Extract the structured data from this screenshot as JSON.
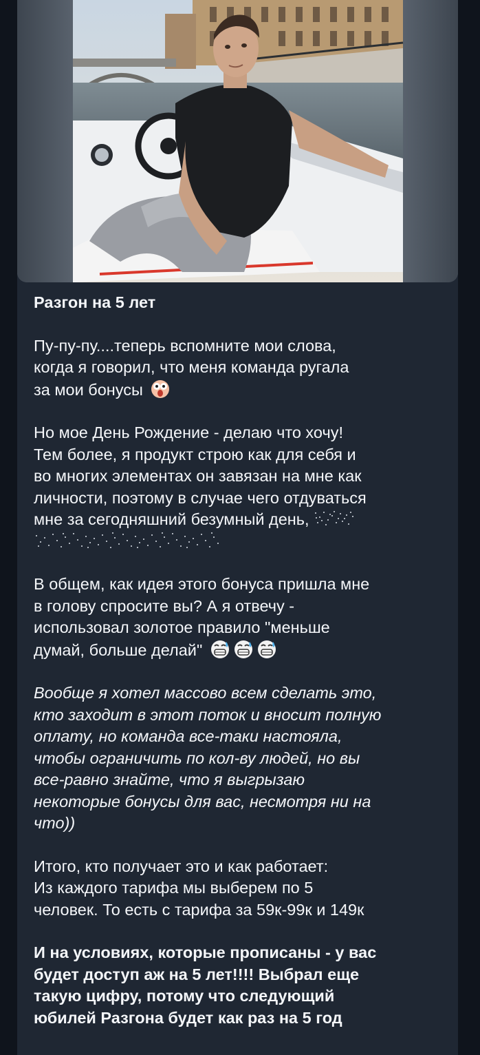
{
  "post": {
    "photo_alt": "photo",
    "title": "Разгон на 5 лет",
    "paragraphs": [
      {
        "style": "normal",
        "lines": [
          "Пу-пу-пу....теперь вспомните мои слова,",
          "когда я говорил, что меня команда ругала",
          "за мои бонусы"
        ],
        "trailing_emoji": [
          "shocked-face-emoji"
        ]
      },
      {
        "style": "normal",
        "lines": [
          "Но мое День Рождение - делаю что хочу!",
          "Тем более, я продукт строю как для себя и",
          "во многих элементах он завязан на мне как",
          "личности, поэтому в случае чего отдуваться",
          "мне за сегодняшний безумный день,"
        ],
        "spoiler": true
      },
      {
        "style": "normal",
        "lines": [
          "В общем, как идея этого бонуса пришла мне",
          "в голову спросите вы? А я отвечу -",
          "использовал золотое правило \"меньше",
          "думай, больше делай\""
        ],
        "trailing_emoji": [
          "grinning-sweat-emoji",
          "grinning-sweat-emoji",
          "grinning-sweat-emoji"
        ]
      },
      {
        "style": "italic",
        "lines": [
          "Вообще я хотел массово всем сделать это,",
          "кто заходит в этот поток и вносит полную",
          "оплату, но команда все-таки настояла,",
          "чтобы ограничить по кол-ву людей, но вы",
          "все-равно знайте, что я выгрызаю",
          "некоторые бонусы для вас, несмотря ни на",
          "что))"
        ]
      },
      {
        "style": "normal",
        "lines": [
          "Итого, кто получает это и как работает:",
          "Из каждого тарифа мы выберем по 5",
          "человек. То есть с тарифа за 59к-99к и 149к"
        ]
      },
      {
        "style": "bold",
        "lines": [
          "И на условиях, которые прописаны - у вас",
          "будет доступ аж на 5 лет!!!! Выбрал еще",
          "такую цифру, потому что следующий",
          "юбилей Разгона будет как раз на 5 год"
        ]
      }
    ]
  },
  "colors": {
    "background": "#0f141c",
    "bubble": "#1f2733",
    "text": "#f4f6f9"
  }
}
